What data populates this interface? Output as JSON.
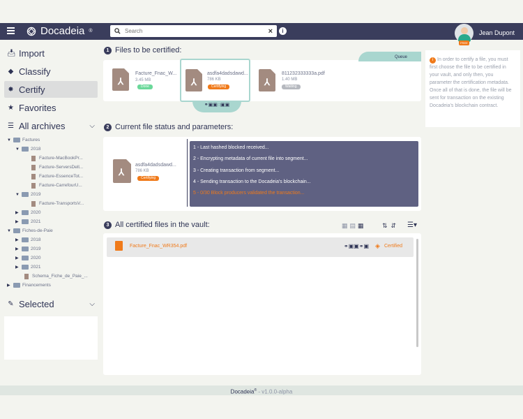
{
  "header": {
    "app_name": "Docadeia",
    "app_reg": "®",
    "search_placeholder": "Search",
    "user_name": "Jean Dupont",
    "user_plan": "FREE"
  },
  "sidebar": {
    "nav": [
      {
        "label": "Import",
        "icon": "file-import-icon"
      },
      {
        "label": "Classify",
        "icon": "tags-icon"
      },
      {
        "label": "Certify",
        "icon": "certificate-icon"
      },
      {
        "label": "Favorites",
        "icon": "star-icon"
      }
    ],
    "archives_label": "All archives",
    "tree": {
      "factures": "Factures",
      "y2018": "2018",
      "f1": "Facture-MacBookPr...",
      "f2": "Facture-ServersDell...",
      "f3": "Facture-EssenceTot...",
      "f4": "Facture-CarrefourU...",
      "y2019": "2019",
      "f5": "Facture-TransportsV...",
      "y2020": "2020",
      "y2021": "2021",
      "fiches": "Fiches-de-Paie",
      "p2018": "2018",
      "p2019": "2019",
      "p2020": "2020",
      "p2021": "2021",
      "schema": "Schema_Fiche_de_Paie_...",
      "financements": "Financements"
    },
    "selected_label": "Selected"
  },
  "step1": {
    "num": "1",
    "title": "Files to be certified:",
    "queue_label": "Queue",
    "files": [
      {
        "name": "Facture_Fnac_W...",
        "size": "3.45 MB",
        "status": "Done"
      },
      {
        "name": "asdfa4dadsdawd...",
        "size": "786 KB",
        "status": "Certifying"
      },
      {
        "name": "811232333333a.pdf",
        "size": "1.40 MB",
        "status": "Waiting"
      }
    ]
  },
  "step2": {
    "num": "2",
    "title": "Current file status and parameters:",
    "file": {
      "name": "asdfa4dadsdawd...",
      "size": "786 KB",
      "status": "Certifying"
    },
    "log": [
      "1 - Last hashed blocked received...",
      "2 - Encrypting metadata of current file into segment...",
      "3 - Creating transaction from segment...",
      "4 - Sending transaction to the Docadeia's blockchain...",
      "5 - 0/30 Block producers validated the transaction..."
    ]
  },
  "step3": {
    "num": "3",
    "title": "All certified files in the vault:",
    "row": {
      "name": "Facture_Fnac_WR354.pdf",
      "status": "Certified"
    }
  },
  "info": {
    "text": "In order to certify a file, you must first choose the file to be certified in your vault, and only then, you parameter the certification metadata. Once all of that is done, the file will be sent for transaction on the existing Docadeia's blockchain contract."
  },
  "footer": {
    "brand": "Docadeia",
    "reg": "®",
    "version": "- v1.0.0-alpha"
  },
  "colors": {
    "topbar": "#3a3d5c",
    "accent_orange": "#f07a1a",
    "done_green": "#6bd89a",
    "teal": "#a9d6cf",
    "log_bg": "#5f6182"
  }
}
